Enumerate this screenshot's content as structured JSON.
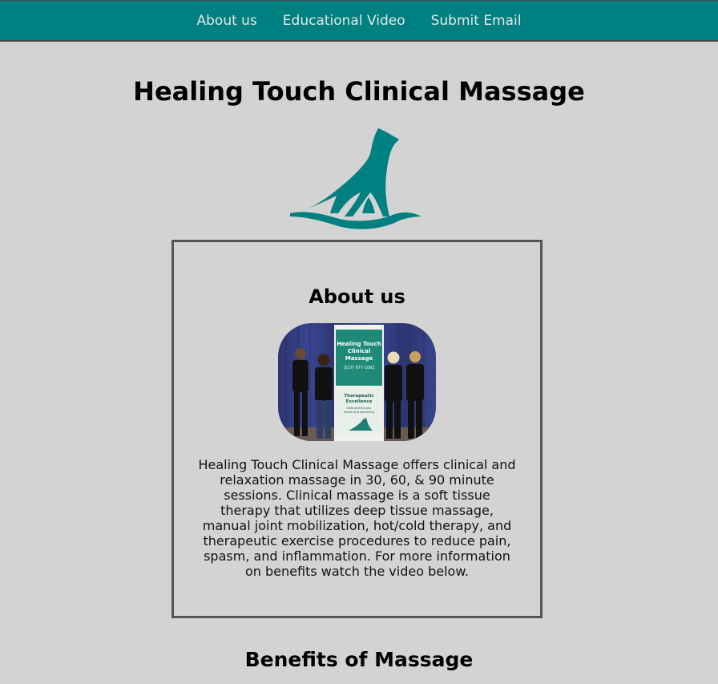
{
  "nav": {
    "items": [
      {
        "label": "About us"
      },
      {
        "label": "Educational Video"
      },
      {
        "label": "Submit Email"
      }
    ]
  },
  "header": {
    "title": "Healing Touch Clinical Massage"
  },
  "logo": {
    "icon": "hand-on-rocker-logo-icon",
    "color": "#008080"
  },
  "about": {
    "heading": "About us",
    "photo": {
      "banner_title": "Healing Touch Clinical Massage",
      "banner_phone": "(517) 977-1092",
      "banner_tagline": "Therapeutic Excellence",
      "banner_subtext": "Dedicated to your health and well-being"
    },
    "body": "Healing Touch Clinical Massage offers clinical and relaxation massage in 30, 60, & 90 minute sessions. Clinical massage is a soft tissue therapy that utilizes deep tissue massage, manual joint mobilization, hot/cold therapy, and therapeutic exercise procedures to reduce pain, spasm, and inflammation. For more information on benefits watch the video below."
  },
  "benefits": {
    "heading": "Benefits of Massage"
  },
  "colors": {
    "accent": "#008080",
    "background": "#d3d3d3",
    "border": "#555555"
  }
}
